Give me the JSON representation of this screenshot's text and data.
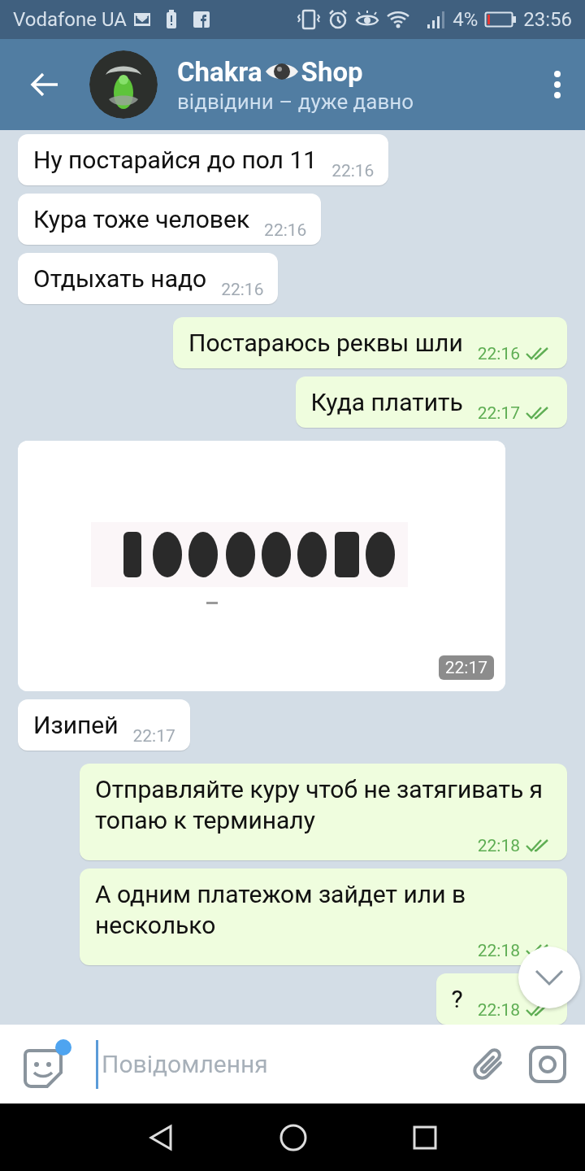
{
  "status_bar": {
    "carrier": "Vodafone UA",
    "battery_percent": "4%",
    "time": "23:56"
  },
  "header": {
    "title_before": "Chakra",
    "title_after": "Shop",
    "subtitle": "відвідини – дуже давно"
  },
  "messages": [
    {
      "kind": "incoming",
      "text": "Ну постарайся до пол 11",
      "time": "22:16"
    },
    {
      "kind": "incoming",
      "text": "Кура тоже человек",
      "time": "22:16"
    },
    {
      "kind": "incoming",
      "text": "Отдыхать надо",
      "time": "22:16"
    },
    {
      "kind": "outgoing",
      "text": "Постараюсь реквы шли",
      "time": "22:16",
      "read": true
    },
    {
      "kind": "outgoing",
      "text": "Куда платить",
      "time": "22:17",
      "read": true
    },
    {
      "time": "22:17"
    },
    {
      "kind": "incoming",
      "text": "Изипей",
      "time": "22:17"
    },
    {
      "kind": "outgoing",
      "text": "Отправляйте куру чтоб не затягивать я топаю к терминалу",
      "time": "22:18",
      "read": true
    },
    {
      "kind": "outgoing",
      "text": "А одним платежом зайдет или в несколько",
      "time": "22:18",
      "read": true
    },
    {
      "kind": "outgoing",
      "text": "?",
      "time": "22:18",
      "read": true
    }
  ],
  "composer": {
    "placeholder": "Повідомлення",
    "sticker_badge": true
  }
}
